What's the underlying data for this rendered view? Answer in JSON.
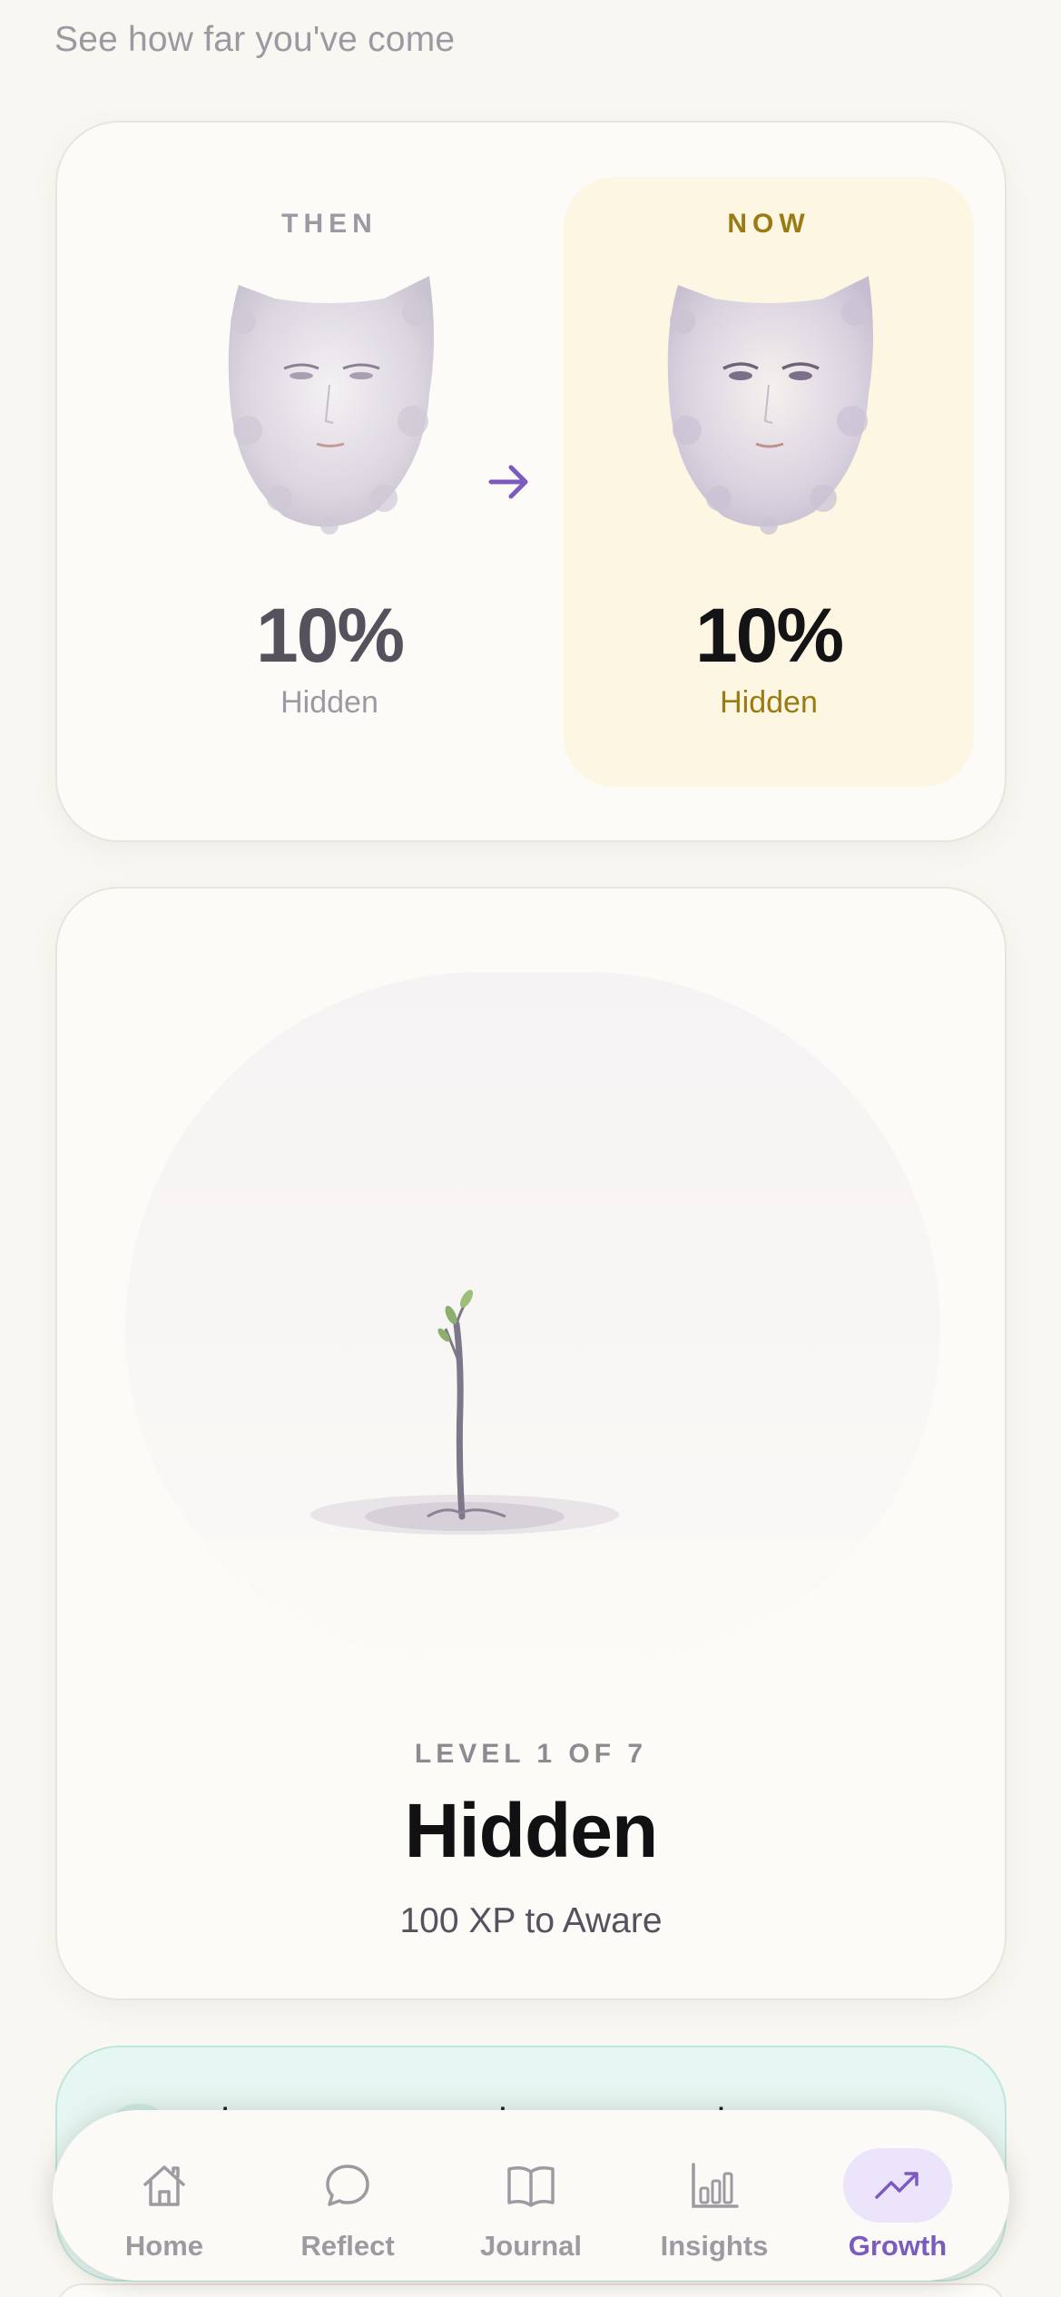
{
  "header": {
    "subtitle": "See how far you've come"
  },
  "comparison": {
    "then": {
      "label": "THEN",
      "percent": "10%",
      "stage": "Hidden"
    },
    "now": {
      "label": "NOW",
      "percent": "10%",
      "stage": "Hidden"
    }
  },
  "level": {
    "label": "LEVEL 1 OF 7",
    "title": "Hidden",
    "xp_text": "100 XP to Aware"
  },
  "teaser": {
    "text": "what patterns tend to appear when you get"
  },
  "nav": {
    "items": [
      {
        "label": "Home",
        "icon": "home-icon"
      },
      {
        "label": "Reflect",
        "icon": "chat-bubble-icon"
      },
      {
        "label": "Journal",
        "icon": "book-icon"
      },
      {
        "label": "Insights",
        "icon": "bar-chart-icon"
      },
      {
        "label": "Growth",
        "icon": "trending-up-icon",
        "active": true
      }
    ]
  },
  "colors": {
    "background": "#f9f7f2",
    "accent": "#7b5bbf",
    "gold": "#9a7a12",
    "now_highlight": "#fdf6e3",
    "teaser": "#e6f6f2"
  }
}
